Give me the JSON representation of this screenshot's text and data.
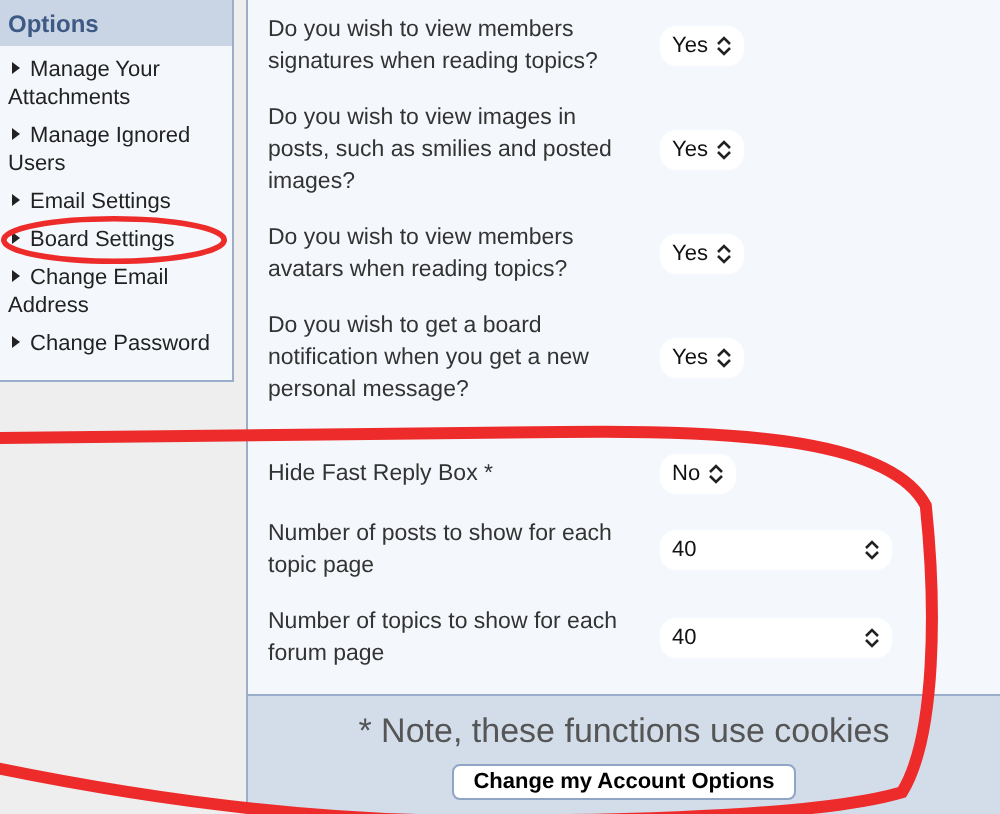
{
  "sidebar": {
    "title": "Options",
    "items": [
      {
        "label": "Manage Your Attachments",
        "circled": false
      },
      {
        "label": "Manage Ignored Users",
        "circled": false
      },
      {
        "label": "Email Settings",
        "circled": false
      },
      {
        "label": "Board Settings",
        "circled": true
      },
      {
        "label": "Change Email Address",
        "circled": false
      },
      {
        "label": "Change Password",
        "circled": false
      }
    ]
  },
  "settings": [
    {
      "label": "Do you wish to view members signatures when reading topics?",
      "value": "Yes",
      "kind": "short",
      "circled": false
    },
    {
      "label": "Do you wish to view images in posts, such as smilies and posted images?",
      "value": "Yes",
      "kind": "short",
      "circled": false
    },
    {
      "label": "Do you wish to view members avatars when reading topics?",
      "value": "Yes",
      "kind": "short",
      "circled": false
    },
    {
      "label": "Do you wish to get a board notification when you get a new personal message?",
      "value": "Yes",
      "kind": "short",
      "circled": false
    },
    {
      "label": "Hide Fast Reply Box *",
      "value": "No",
      "kind": "short",
      "circled": true
    },
    {
      "label": "Number of posts to show for each topic page",
      "value": "40",
      "kind": "wide",
      "circled": true
    },
    {
      "label": "Number of topics to show for each forum page",
      "value": "40",
      "kind": "wide",
      "circled": true
    }
  ],
  "footer": {
    "note": "* Note, these functions use cookies",
    "button": "Change my Account Options"
  }
}
